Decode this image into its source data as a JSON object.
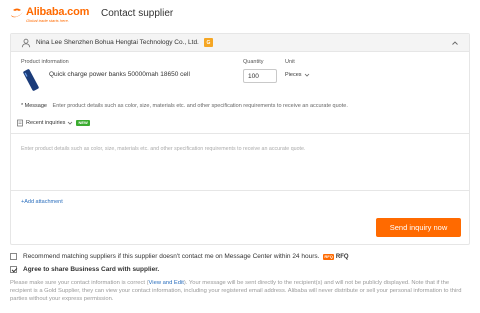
{
  "header": {
    "logo_name": "Alibaba.com",
    "logo_tagline": "Global trade starts here.",
    "title": "Contact supplier"
  },
  "supplier": {
    "name": "Nina Lee Shenzhen Bohua Hengtai Technology Co., Ltd.",
    "badge": "G"
  },
  "product": {
    "info_label": "Product information",
    "name": "Quick charge power banks 50000mah 18650 cell",
    "quantity_label": "Quantity",
    "quantity_value": "100",
    "unit_label": "Unit",
    "unit_value": "Pieces"
  },
  "message": {
    "required_mark": "*",
    "label": "Message",
    "hint": "Enter product details such as color, size, materials etc. and other specification requirements to receive an accurate quote.",
    "placeholder": "Enter product details such as color, size, materials etc. and other specification requirements to receive an accurate quote."
  },
  "recent_inquiries": {
    "label": "Recent inquiries",
    "badge": "NEW"
  },
  "attachment_label": "+Add attachment",
  "send_button": "Send inquiry now",
  "options": {
    "recommend_label": "Recommend matching suppliers if this supplier doesn't contact me on Message Center within 24 hours.",
    "recommend_checked": false,
    "rfq_badge": "RFQ",
    "rfq_text": "RFQ",
    "share_card_label": "Agree to share Business Card with supplier.",
    "share_card_checked": true
  },
  "notice": {
    "before_link": "Please make sure your contact information is correct (",
    "link": "View and Edit",
    "after_link": "). Your message will be sent directly to the recipient(s) and will not be publicly displayed. Note that if the recipient is a Gold Supplier, they can view your contact information, including your registered email address. Alibaba will never distribute or sell your personal information to third parties without your express permission."
  },
  "colors": {
    "brand": "#ff6a00",
    "link": "#2a6ebd",
    "new_badge": "#3aab2f",
    "gold_badge": "#f5a623"
  },
  "icons": [
    "alibaba-logo-icon",
    "user-icon",
    "chevron-up-icon",
    "chevron-down-icon",
    "document-icon"
  ]
}
